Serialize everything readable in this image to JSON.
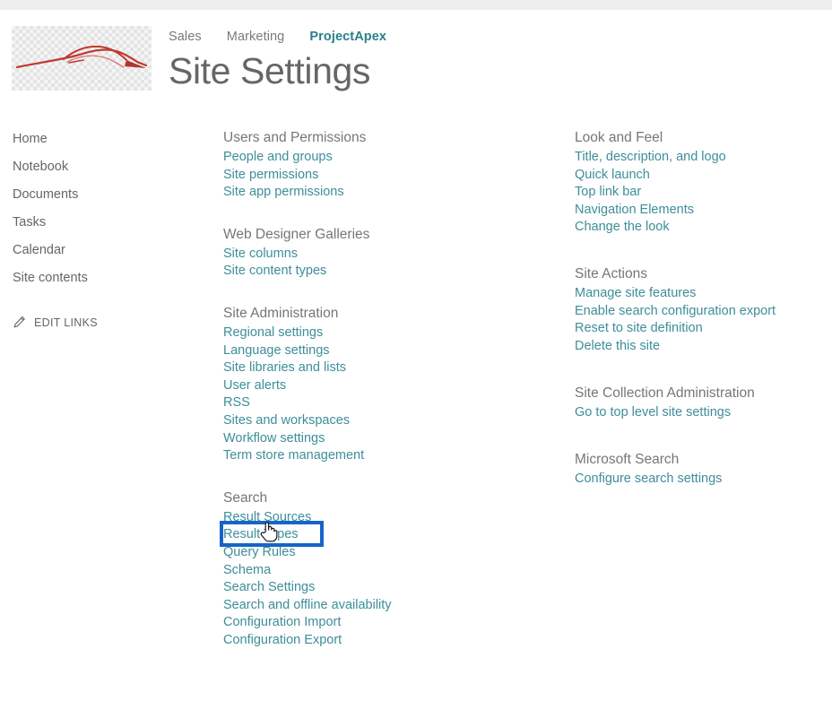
{
  "chrome": {
    "top_strip_color": "#eeeeee"
  },
  "branding": {
    "logo_name": "site-logo-car-silhouette",
    "logo_color": "#c0392f"
  },
  "topnav": {
    "items": [
      {
        "label": "Sales",
        "active": false
      },
      {
        "label": "Marketing",
        "active": false
      },
      {
        "label": "ProjectApex",
        "active": true
      }
    ],
    "active_color": "#2b7f8c"
  },
  "header": {
    "title": "Site Settings"
  },
  "quicklaunch": {
    "items": [
      {
        "label": "Home"
      },
      {
        "label": "Notebook"
      },
      {
        "label": "Documents"
      },
      {
        "label": "Tasks"
      },
      {
        "label": "Calendar"
      },
      {
        "label": "Site contents"
      }
    ],
    "edit_links_label": "EDIT LINKS",
    "edit_links_icon": "pencil-icon"
  },
  "settings": {
    "link_color": "#3d8e99",
    "heading_color": "#767676",
    "middle_column": [
      {
        "title": "Users and Permissions",
        "links": [
          "People and groups",
          "Site permissions",
          "Site app permissions"
        ]
      },
      {
        "title": "Web Designer Galleries",
        "links": [
          "Site columns",
          "Site content types"
        ]
      },
      {
        "title": "Site Administration",
        "links": [
          "Regional settings",
          "Language settings",
          "Site libraries and lists",
          "User alerts",
          "RSS",
          "Sites and workspaces",
          "Workflow settings",
          "Term store management"
        ]
      },
      {
        "title": "Search",
        "links": [
          "Result Sources",
          "Result Types",
          "Query Rules",
          "Schema",
          "Search Settings",
          "Search and offline availability",
          "Configuration Import",
          "Configuration Export"
        ]
      }
    ],
    "right_column": [
      {
        "title": "Look and Feel",
        "links": [
          "Title, description, and logo",
          "Quick launch",
          "Top link bar",
          "Navigation Elements",
          "Change the look"
        ]
      },
      {
        "title": "Site Actions",
        "links": [
          "Manage site features",
          "Enable search configuration export",
          "Reset to site definition",
          "Delete this site"
        ]
      },
      {
        "title": "Site Collection Administration",
        "links": [
          "Go to top level site settings"
        ]
      },
      {
        "title": "Microsoft Search",
        "links": [
          "Configure search settings"
        ]
      }
    ]
  },
  "annotation": {
    "highlight_target": "Result Sources",
    "highlight_color": "#1565c8",
    "cursor_icon": "pointing-hand-cursor"
  }
}
